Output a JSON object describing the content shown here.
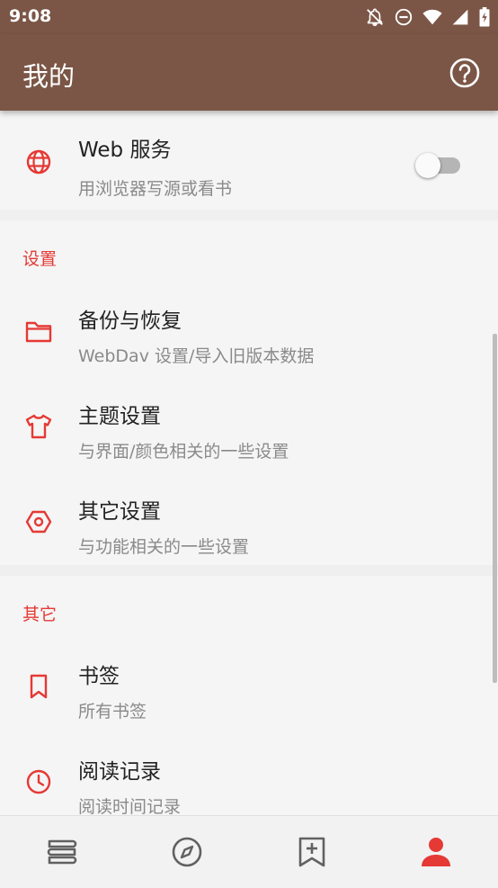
{
  "status_bar": {
    "time": "9:08",
    "icons": [
      "notifications-off-icon",
      "do-not-disturb-icon",
      "wifi-icon",
      "signal-icon",
      "battery-charging-icon"
    ]
  },
  "app_bar": {
    "title": "我的",
    "help_icon": "help-circle-icon"
  },
  "web_service": {
    "title": "Web 服务",
    "subtitle": "用浏览器写源或看书",
    "icon": "globe-icon",
    "enabled": false
  },
  "settings_section": {
    "title": "设置",
    "items": [
      {
        "title": "备份与恢复",
        "subtitle": "WebDav 设置/导入旧版本数据",
        "icon": "folder-icon"
      },
      {
        "title": "主题设置",
        "subtitle": "与界面/颜色相关的一些设置",
        "icon": "tshirt-icon"
      },
      {
        "title": "其它设置",
        "subtitle": "与功能相关的一些设置",
        "icon": "hexagon-settings-icon"
      }
    ]
  },
  "other_section": {
    "title": "其它",
    "items": [
      {
        "title": "书签",
        "subtitle": "所有书签",
        "icon": "bookmark-icon"
      },
      {
        "title": "阅读记录",
        "subtitle": "阅读时间记录",
        "icon": "clock-icon"
      }
    ]
  },
  "bottom_nav": {
    "items": [
      {
        "icon": "bookshelf-icon",
        "active": false
      },
      {
        "icon": "compass-icon",
        "active": false
      },
      {
        "icon": "rss-bookmark-icon",
        "active": false
      },
      {
        "icon": "person-icon",
        "active": true
      }
    ]
  },
  "colors": {
    "primary": "#7b5646",
    "accent": "#e53935",
    "background": "#f5f5f5"
  }
}
